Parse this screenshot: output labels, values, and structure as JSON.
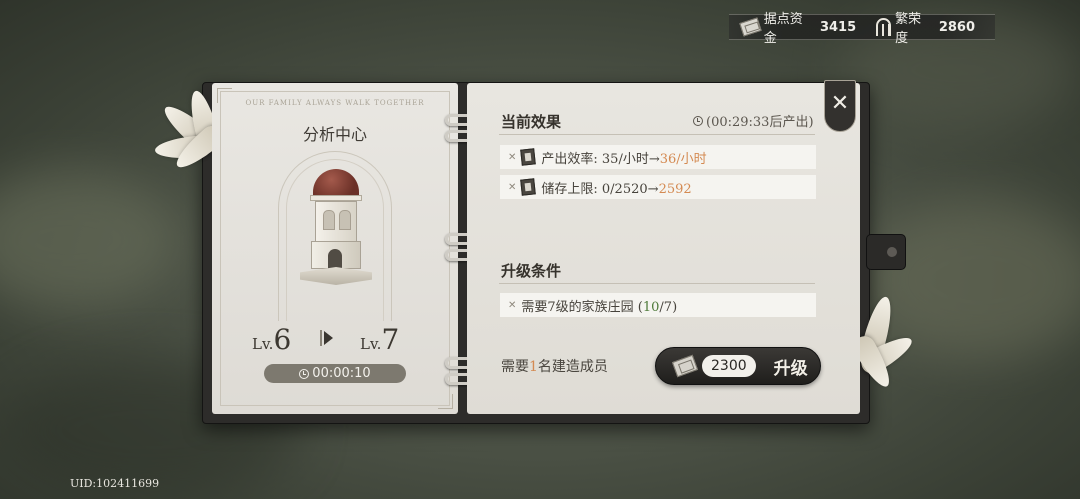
{
  "resources": {
    "funds_label": "据点资金",
    "funds_value": "3415",
    "prosperity_label": "繁荣度",
    "prosperity_value": "2860"
  },
  "building": {
    "motto": "OUR FAMILY ALWAYS WALK TOGETHER",
    "name": "分析中心",
    "level_prefix": "Lv.",
    "current_level": "6",
    "next_level": "7",
    "upgrade_time": "00:00:10"
  },
  "current_effect": {
    "title": "当前效果",
    "countdown": "(00:29:33后产出)",
    "items": [
      {
        "label": "产出效率: ",
        "current": "35/小时",
        "arrow": "→",
        "next": "36/小时"
      },
      {
        "label": "储存上限: ",
        "current": "0/2520",
        "arrow": "→",
        "next": "2592"
      }
    ]
  },
  "upgrade_conditions": {
    "title": "升级条件",
    "items": [
      {
        "text_before": "需要7级的家族庄园 (",
        "progress": "10",
        "text_after": "/7)"
      }
    ]
  },
  "builder_req": {
    "before": "需要",
    "count": "1",
    "after": "名建造成员"
  },
  "upgrade_button": {
    "cost": "2300",
    "label": "升级"
  },
  "close_label": "✕",
  "uid": "UID:102411699",
  "colors": {
    "highlight": "#d48a52",
    "progress_green": "#4e7a3a"
  }
}
